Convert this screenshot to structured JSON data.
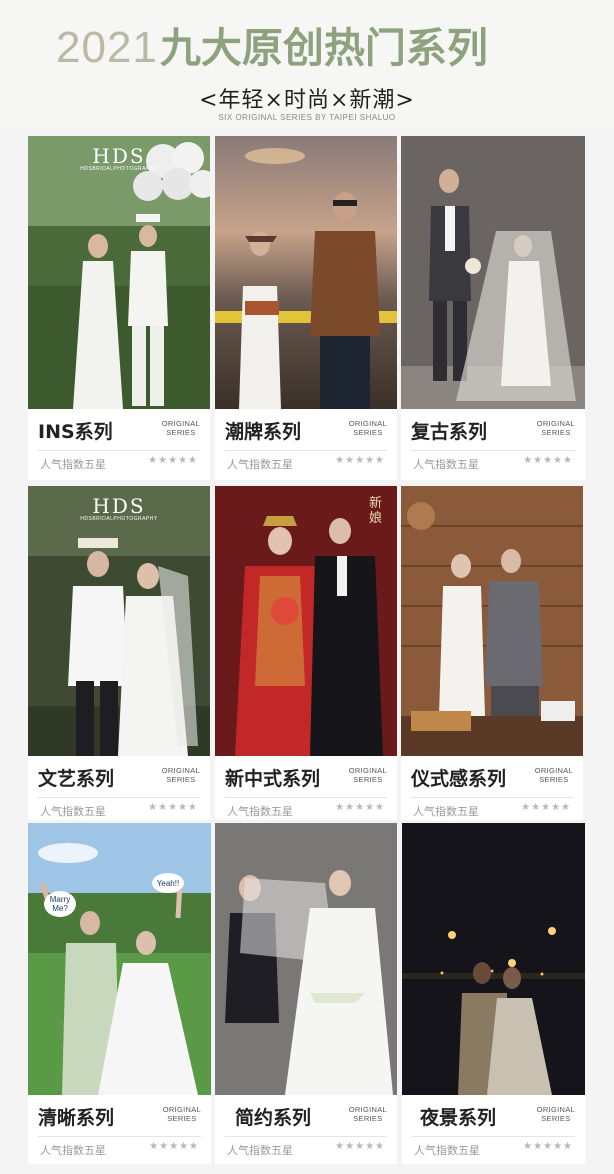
{
  "header": {
    "year": "2021",
    "title": "九大原创热门系列",
    "tagline": "<年轻×时尚×新潮>",
    "subline": "SIX ORIGINAL SERIES BY TAIPEI SHALUO"
  },
  "common": {
    "original_line1": "ORIGINAL",
    "original_line2": "SERIES",
    "popularity": "人气指数五星",
    "stars": "★★★★★"
  },
  "cards": [
    {
      "name": "INS系列",
      "logo": "HDS",
      "logo_small": "HDSBRIDALPHOTOGRAPHY"
    },
    {
      "name": "潮牌系列"
    },
    {
      "name": "复古系列"
    },
    {
      "name": "文艺系列",
      "logo": "HDS",
      "logo_small": "HDSBRIDALPHOTOGRAPHY"
    },
    {
      "name": "新中式系列",
      "seal": "新娘"
    },
    {
      "name": "仪式感系列"
    },
    {
      "name": "清晰系列",
      "badge1": "Marry Me?",
      "badge2": "Yeah!!"
    },
    {
      "name": "简约系列"
    },
    {
      "name": "夜景系列"
    }
  ]
}
